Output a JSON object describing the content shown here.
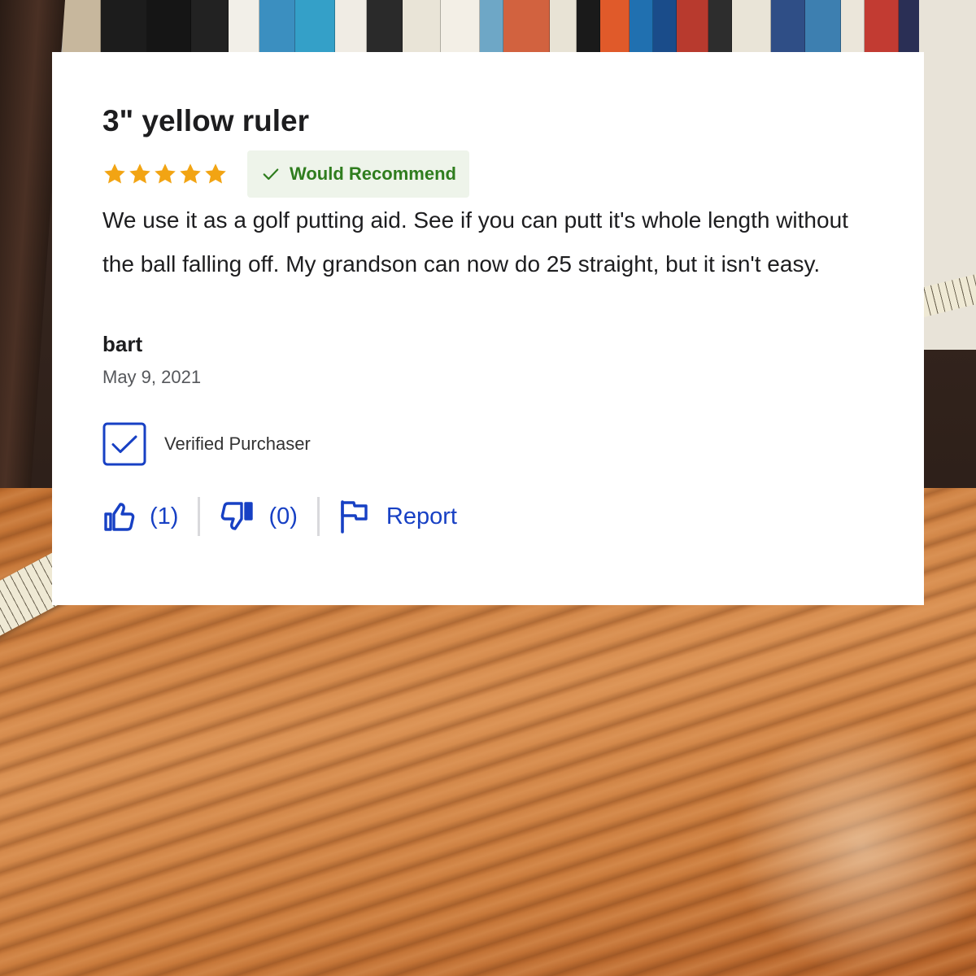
{
  "review": {
    "title": "3\" yellow ruler",
    "rating": 5,
    "rating_max": 5,
    "recommend_label": "Would Recommend",
    "body": "We use it as a golf putting aid. See if you can putt it's whole length without the ball falling off. My grandson can now do 25 straight, but it isn't easy.",
    "author": "bart",
    "date": "May 9, 2021",
    "verified_label": "Verified Purchaser"
  },
  "actions": {
    "helpful_count": "(1)",
    "unhelpful_count": "(0)",
    "report_label": "Report"
  },
  "icons": {
    "star": "star-icon",
    "recommend": "checkmark-icon",
    "verified": "checkbox-checked-icon",
    "helpful": "thumbs-up-icon",
    "unhelpful": "thumbs-down-icon",
    "report": "flag-icon"
  },
  "colors": {
    "star": "#f2a413",
    "recommend_text": "#2f7d1e",
    "recommend_bg": "#eef4ea",
    "link_blue": "#1740c4",
    "text": "#1d1d1f",
    "muted": "#55575b",
    "card_bg": "#ffffff"
  }
}
